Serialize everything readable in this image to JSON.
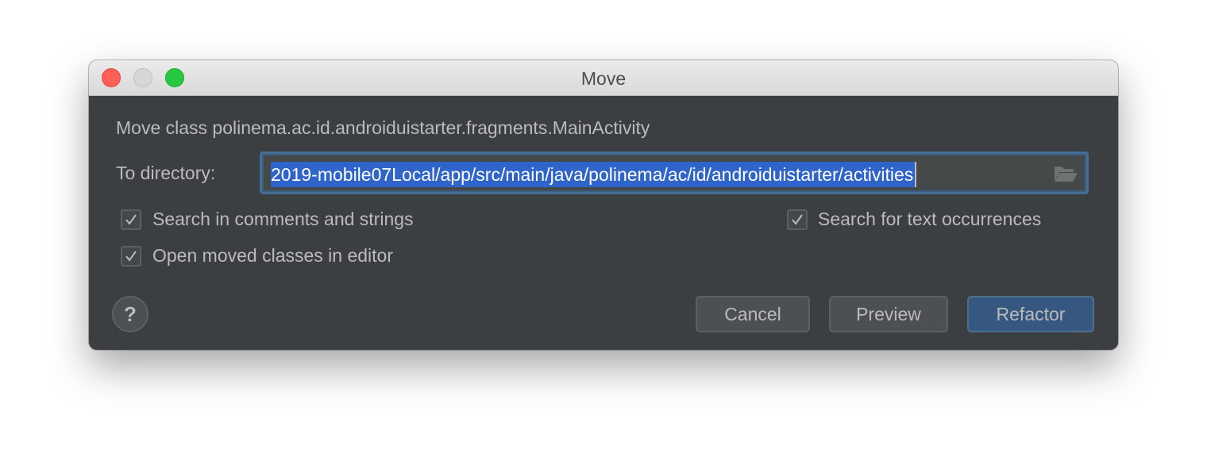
{
  "window": {
    "title": "Move",
    "traffic_lights": {
      "close": "#fe5f57",
      "minimize": "#d7d7d7",
      "zoom": "#28c840"
    }
  },
  "dialog": {
    "description": "Move class polinema.ac.id.androiduistarter.fragments.MainActivity",
    "directory_label": "To directory:",
    "directory_value": "2019-mobile07Local/app/src/main/java/polinema/ac/id/androiduistarter/activities",
    "browse_icon": "folder-icon",
    "options": [
      {
        "label": "Search in comments and strings",
        "checked": true
      },
      {
        "label": "Search for text occurrences",
        "checked": true
      },
      {
        "label": "Open moved classes in editor",
        "checked": true
      }
    ],
    "help_label": "?",
    "buttons": {
      "cancel": "Cancel",
      "preview": "Preview",
      "refactor": "Refactor"
    },
    "accent": "#365880",
    "selection": "#2f65ca"
  }
}
